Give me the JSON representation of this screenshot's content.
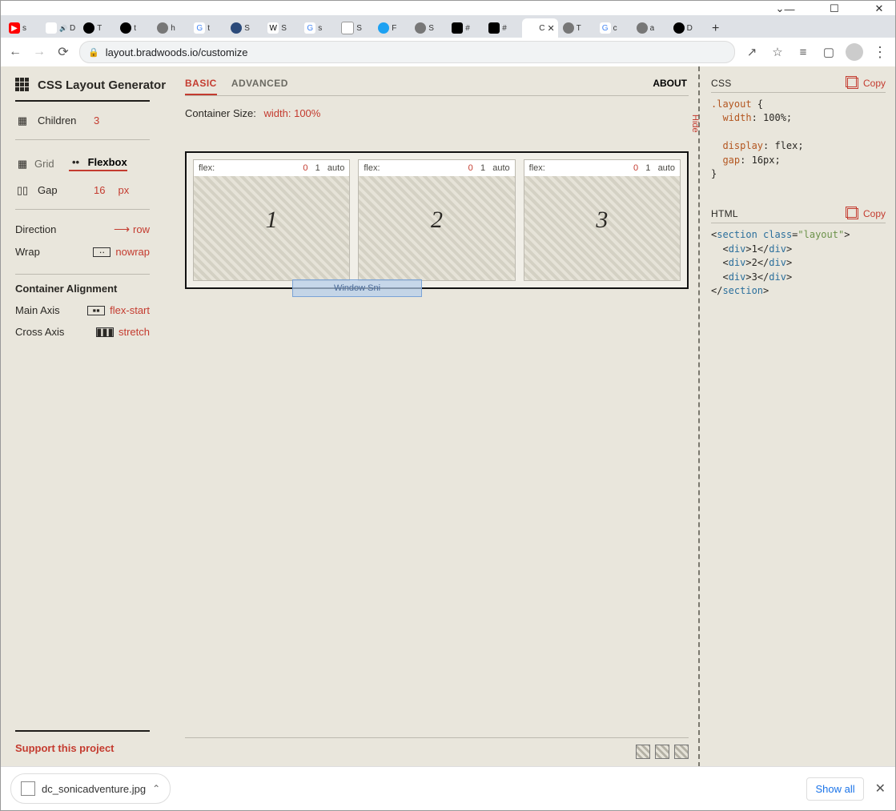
{
  "window": {
    "close": "✕",
    "max": "☐",
    "min": "—",
    "dropdown": "⌄"
  },
  "browser": {
    "tabs": [
      {
        "label": "s",
        "fav": "▶",
        "favbg": "#f00",
        "color": "#fff"
      },
      {
        "label": "D",
        "fav": "",
        "favbg": "#fff",
        "color": "#333",
        "audio": true
      },
      {
        "label": "T",
        "fav": "",
        "favbg": "#000",
        "color": "#fff",
        "round": true
      },
      {
        "label": "t",
        "fav": "",
        "favbg": "#000",
        "color": "#fff",
        "round": true
      },
      {
        "label": "h",
        "fav": "",
        "favbg": "#777",
        "color": "#fff",
        "round": true
      },
      {
        "label": "t",
        "fav": "G",
        "favbg": "#fff",
        "color": "#4285f4"
      },
      {
        "label": "S",
        "fav": "",
        "favbg": "#2b4a7a",
        "color": "#fff",
        "round": true
      },
      {
        "label": "S",
        "fav": "W",
        "favbg": "#fff",
        "color": "#000"
      },
      {
        "label": "s",
        "fav": "G",
        "favbg": "#fff",
        "color": "#4285f4"
      },
      {
        "label": "S",
        "fav": "",
        "favbg": "#fff",
        "color": "#333",
        "border": true
      },
      {
        "label": "F",
        "fav": "",
        "favbg": "#1da1f2",
        "color": "#fff",
        "round": true
      },
      {
        "label": "S",
        "fav": "",
        "favbg": "#777",
        "color": "#fff",
        "round": true
      },
      {
        "label": "#",
        "fav": "",
        "favbg": "#000",
        "color": "#fff"
      },
      {
        "label": "#",
        "fav": "",
        "favbg": "#000",
        "color": "#fff"
      },
      {
        "label": "C",
        "fav": "",
        "favbg": "#fff",
        "color": "#333",
        "active": true,
        "close": true
      },
      {
        "label": "T",
        "fav": "",
        "favbg": "#777",
        "color": "#fff",
        "round": true
      },
      {
        "label": "c",
        "fav": "G",
        "favbg": "#fff",
        "color": "#4285f4"
      },
      {
        "label": "a",
        "fav": "",
        "favbg": "#777",
        "color": "#fff",
        "round": true
      },
      {
        "label": "D",
        "fav": "",
        "favbg": "#000",
        "color": "#fff",
        "round": true
      }
    ],
    "url": "layout.bradwoods.io/customize",
    "icons": {
      "share": "↗",
      "star": "☆",
      "list": "≡",
      "panel": "▢",
      "menu": "⋮"
    }
  },
  "sidebar": {
    "title": "CSS Layout Generator",
    "children": {
      "label": "Children",
      "value": "3"
    },
    "modes": {
      "grid": "Grid",
      "flexbox": "Flexbox",
      "active": "flexbox"
    },
    "gap": {
      "label": "Gap",
      "value": "16",
      "unit": "px"
    },
    "direction": {
      "label": "Direction",
      "value": "row",
      "arrow": "⟶"
    },
    "wrap": {
      "label": "Wrap",
      "value": "nowrap"
    },
    "alignment_header": "Container Alignment",
    "main_axis": {
      "label": "Main Axis",
      "value": "flex-start"
    },
    "cross_axis": {
      "label": "Cross Axis",
      "value": "stretch"
    },
    "support": "Support this project"
  },
  "main": {
    "tabs": {
      "basic": "BASIC",
      "advanced": "ADVANCED",
      "active": "basic"
    },
    "about": "ABOUT",
    "container_size": {
      "label": "Container Size:",
      "value": "width: 100%"
    },
    "cells": [
      {
        "flex_label": "flex:",
        "g": "0",
        "s": "1",
        "b": "auto",
        "n": "1"
      },
      {
        "flex_label": "flex:",
        "g": "0",
        "s": "1",
        "b": "auto",
        "n": "2"
      },
      {
        "flex_label": "flex:",
        "g": "0",
        "s": "1",
        "b": "auto",
        "n": "3"
      }
    ],
    "snip": "Window Sni"
  },
  "code": {
    "hide": "Hide",
    "css_title": "CSS",
    "html_title": "HTML",
    "copy": "Copy",
    "css": {
      "selector": ".layout",
      "rules": [
        {
          "prop": "width",
          "val": "100%"
        },
        {
          "prop": "display",
          "val": "flex"
        },
        {
          "prop": "gap",
          "val": "16px"
        }
      ]
    },
    "html": {
      "tag": "section",
      "class_attr": "class",
      "class_val": "\"layout\"",
      "items": [
        "1",
        "2",
        "3"
      ]
    }
  },
  "downloads": {
    "file": "dc_sonicadventure.jpg",
    "show_all": "Show all",
    "close": "✕"
  }
}
